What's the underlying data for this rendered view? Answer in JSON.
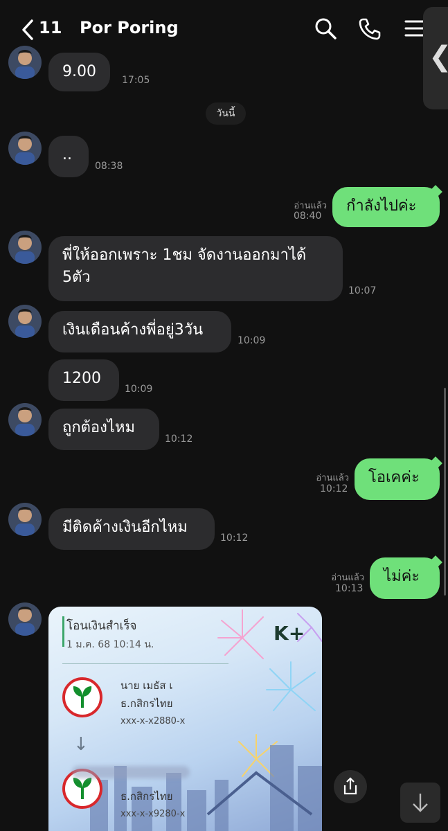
{
  "header": {
    "unread_count": "11",
    "title": "Por Poring"
  },
  "date_separator": "วันนี้",
  "messages": [
    {
      "text": "9.00",
      "time": "17:05"
    },
    {
      "text": "..",
      "time": "08:38"
    },
    {
      "text": "กำลังไปค่ะ",
      "read": "อ่านแล้ว",
      "time": "08:40"
    },
    {
      "text": "พี่ให้ออกเพราะ 1ชม จัดงานออกมาได้ 5ตัว",
      "time": "10:07"
    },
    {
      "text": "เงินเดือนค้างพี่อยู่3วัน",
      "time": "10:09"
    },
    {
      "text": "1200",
      "time": "10:09"
    },
    {
      "text": "ถูกต้องไหม",
      "time": "10:12"
    },
    {
      "text": "โอเคค่ะ",
      "read": "อ่านแล้ว",
      "time": "10:12"
    },
    {
      "text": "มีติดค้างเงินอีกไหม",
      "time": "10:12"
    },
    {
      "text": "ไม่ค่ะ",
      "read": "อ่านแล้ว",
      "time": "10:13"
    }
  ],
  "slip": {
    "title": "โอนเงินสำเร็จ",
    "datetime": "1 ม.ค. 68  10:14 น.",
    "logo": "K+",
    "from_name": "นาย เมธัส เ",
    "from_bank": "ธ.กสิกรไทย",
    "from_account": "xxx-x-x2880-x",
    "to_bank": "ธ.กสิกรไทย",
    "to_account": "xxx-x-x9280-x"
  },
  "colors": {
    "background": "#111111",
    "incoming_bubble": "#2c2c2e",
    "outgoing_bubble": "#6fe07a",
    "kbank_green": "#138f2d",
    "kbank_red": "#d8282c"
  },
  "icons": [
    "back-icon",
    "search-icon",
    "phone-icon",
    "menu-icon",
    "share-icon",
    "scroll-down-icon"
  ]
}
